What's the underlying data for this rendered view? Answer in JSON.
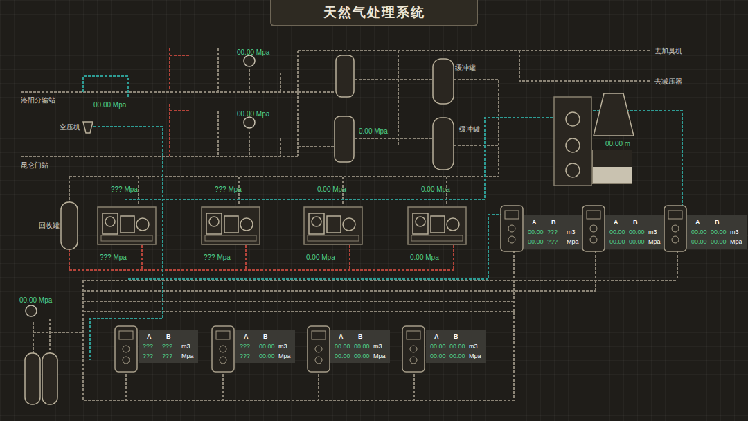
{
  "title": "天然气处理系统",
  "stations": {
    "luoyang": "洛阳分输站",
    "kunlun": "昆仑门站"
  },
  "air_compressor": "空压机",
  "recovery_tank": "回收罐",
  "buffer_tanks": [
    "缓冲罐",
    "缓冲罐"
  ],
  "outlets": [
    "去加臭机",
    "去减压器"
  ],
  "gauges": [
    "00.00 Mpa",
    "00.00 Mpa",
    "00.00 Mpa",
    "0.00 Mpa",
    "00.00 Mpa"
  ],
  "level_tank": {
    "reading": "00.00 m",
    "level": 0.5
  },
  "compressors": [
    {
      "top": "??? Mpa",
      "bottom": "??? Mpa"
    },
    {
      "top": "??? Mpa",
      "bottom": "??? Mpa"
    },
    {
      "top": "0.00 Mpa",
      "bottom": "0.00 Mpa"
    },
    {
      "top": "0.00 Mpa",
      "bottom": "0.00 Mpa"
    }
  ],
  "dispenser_columns": [
    "A",
    "B"
  ],
  "dispenser_units": [
    "m3",
    "Mpa"
  ],
  "dispensers": [
    {
      "rows": [
        [
          "00.00",
          "???"
        ],
        [
          "00.00",
          "???"
        ]
      ]
    },
    {
      "rows": [
        [
          "00.00",
          "00.00"
        ],
        [
          "00.00",
          "00.00"
        ]
      ]
    },
    {
      "rows": [
        [
          "00.00",
          "00.00"
        ],
        [
          "00.00",
          "00.00"
        ]
      ]
    },
    {
      "rows": [
        [
          "???",
          "???"
        ],
        [
          "???",
          "???"
        ]
      ]
    },
    {
      "rows": [
        [
          "???",
          "00.00"
        ],
        [
          "???",
          "00.00"
        ]
      ]
    },
    {
      "rows": [
        [
          "00.00",
          "00.00"
        ],
        [
          "00.00",
          "00.00"
        ]
      ]
    },
    {
      "rows": [
        [
          "00.00",
          "00.00"
        ],
        [
          "00.00",
          "00.00"
        ]
      ]
    }
  ]
}
